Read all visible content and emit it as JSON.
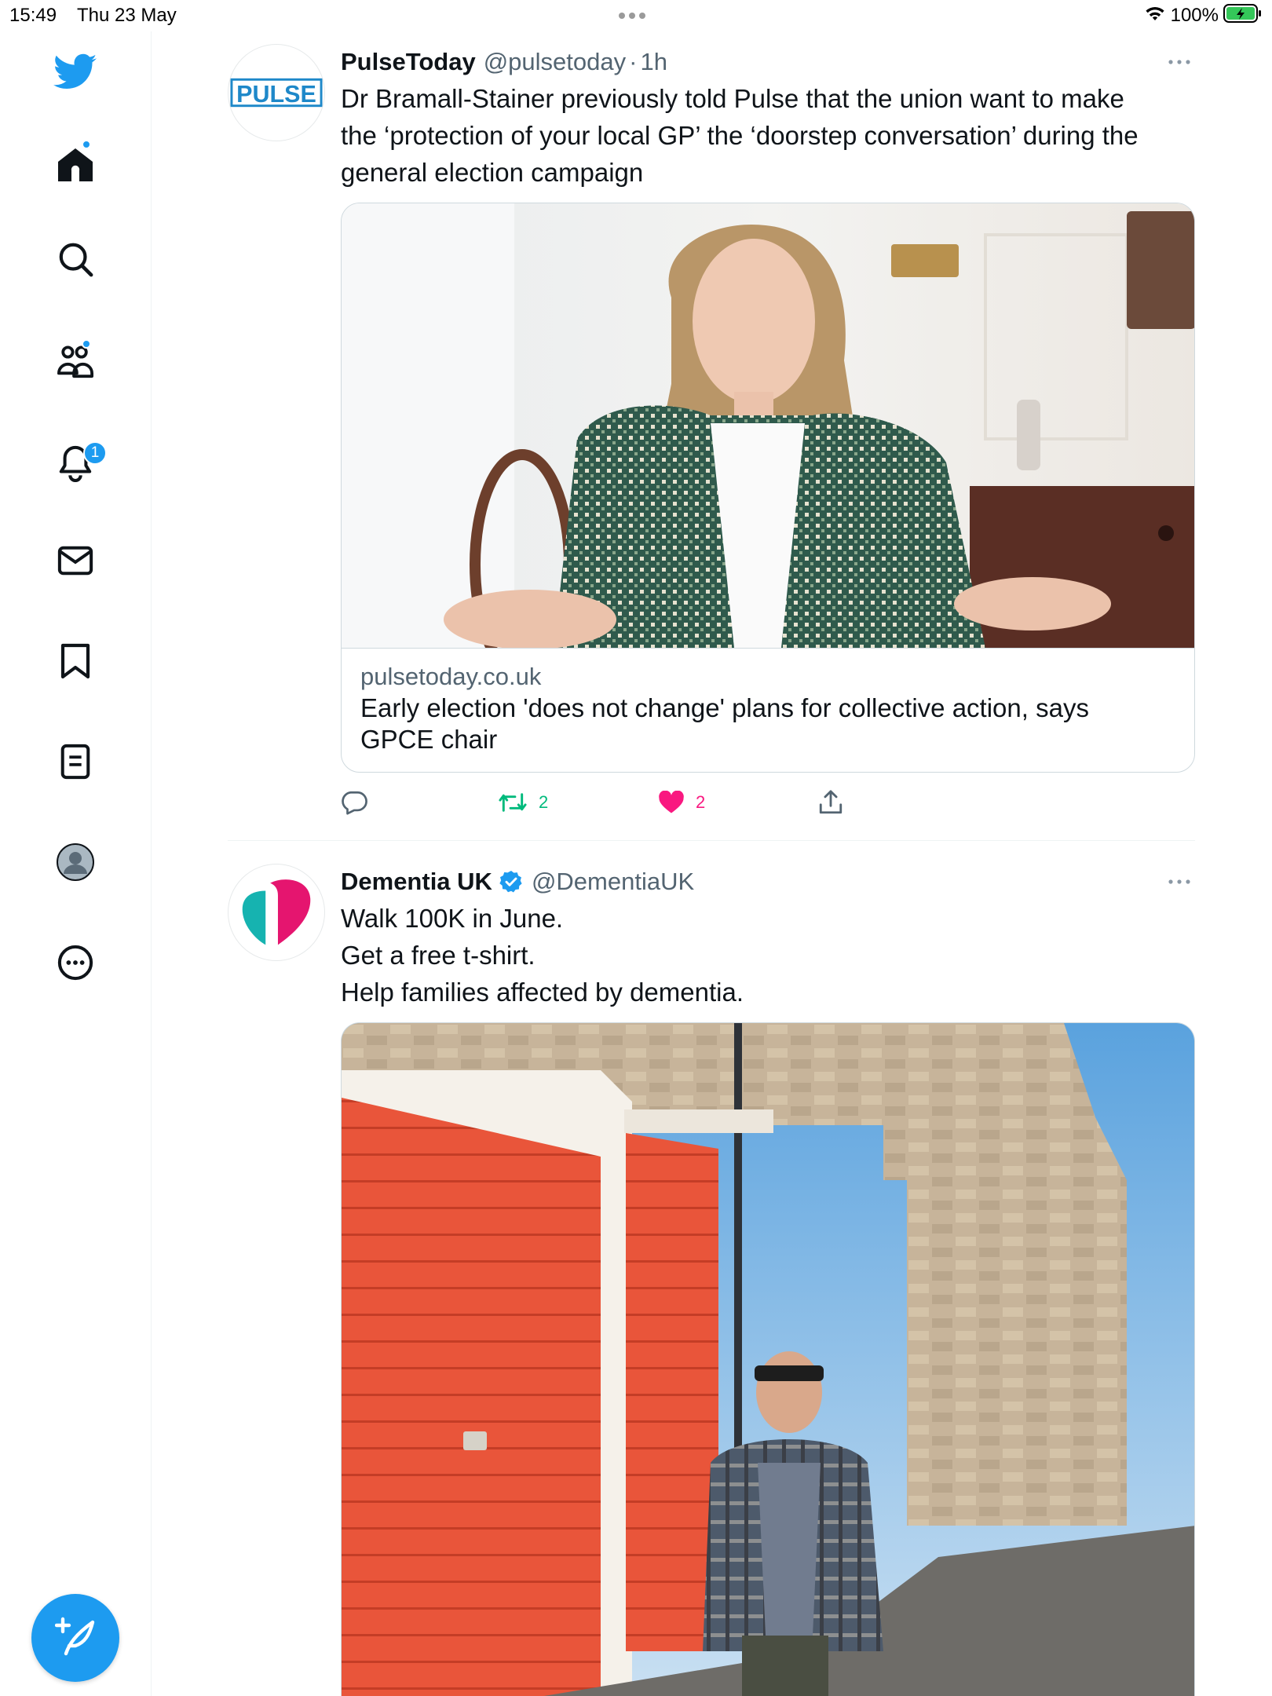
{
  "status_bar": {
    "time": "15:49",
    "date": "Thu 23 May",
    "battery": "100%"
  },
  "sidebar": {
    "items": [
      {
        "name": "twitter-logo"
      },
      {
        "name": "home",
        "has_dot": true
      },
      {
        "name": "explore"
      },
      {
        "name": "communities",
        "has_dot": true
      },
      {
        "name": "notifications",
        "badge": "1"
      },
      {
        "name": "messages"
      },
      {
        "name": "bookmarks"
      },
      {
        "name": "lists"
      },
      {
        "name": "profile"
      },
      {
        "name": "more"
      }
    ],
    "compose_icon": "feather-plus-icon"
  },
  "tweets": [
    {
      "name": "PulseToday",
      "handle": "@pulsetoday",
      "separator": "·",
      "time": "1h",
      "avatar_text": "PULSE",
      "text_lines": [
        "Dr Bramall-Stainer previously told Pulse that the union want to make",
        "the ‘protection of your local GP’ the ‘doorstep conversation’ during the",
        "general election campaign"
      ],
      "card": {
        "domain": "pulsetoday.co.uk",
        "title_lines": [
          "Early election 'does not change' plans for collective action, says",
          "GPCE chair"
        ]
      },
      "retweets": "2",
      "likes": "2",
      "liked": true
    },
    {
      "name": "Dementia UK",
      "handle": "@DementiaUK",
      "verified": true,
      "text_lines": [
        "Walk 100K in June.",
        "Get a free t-shirt.",
        "Help families affected by dementia."
      ]
    }
  ],
  "colors": {
    "accent": "#1d9bf0",
    "retweet": "#00ba7c",
    "like": "#f91880",
    "secondary_text": "#536471",
    "pulse_blue": "#1e88c9",
    "dementia_teal": "#16b3b0",
    "dementia_pink": "#e5156f"
  }
}
